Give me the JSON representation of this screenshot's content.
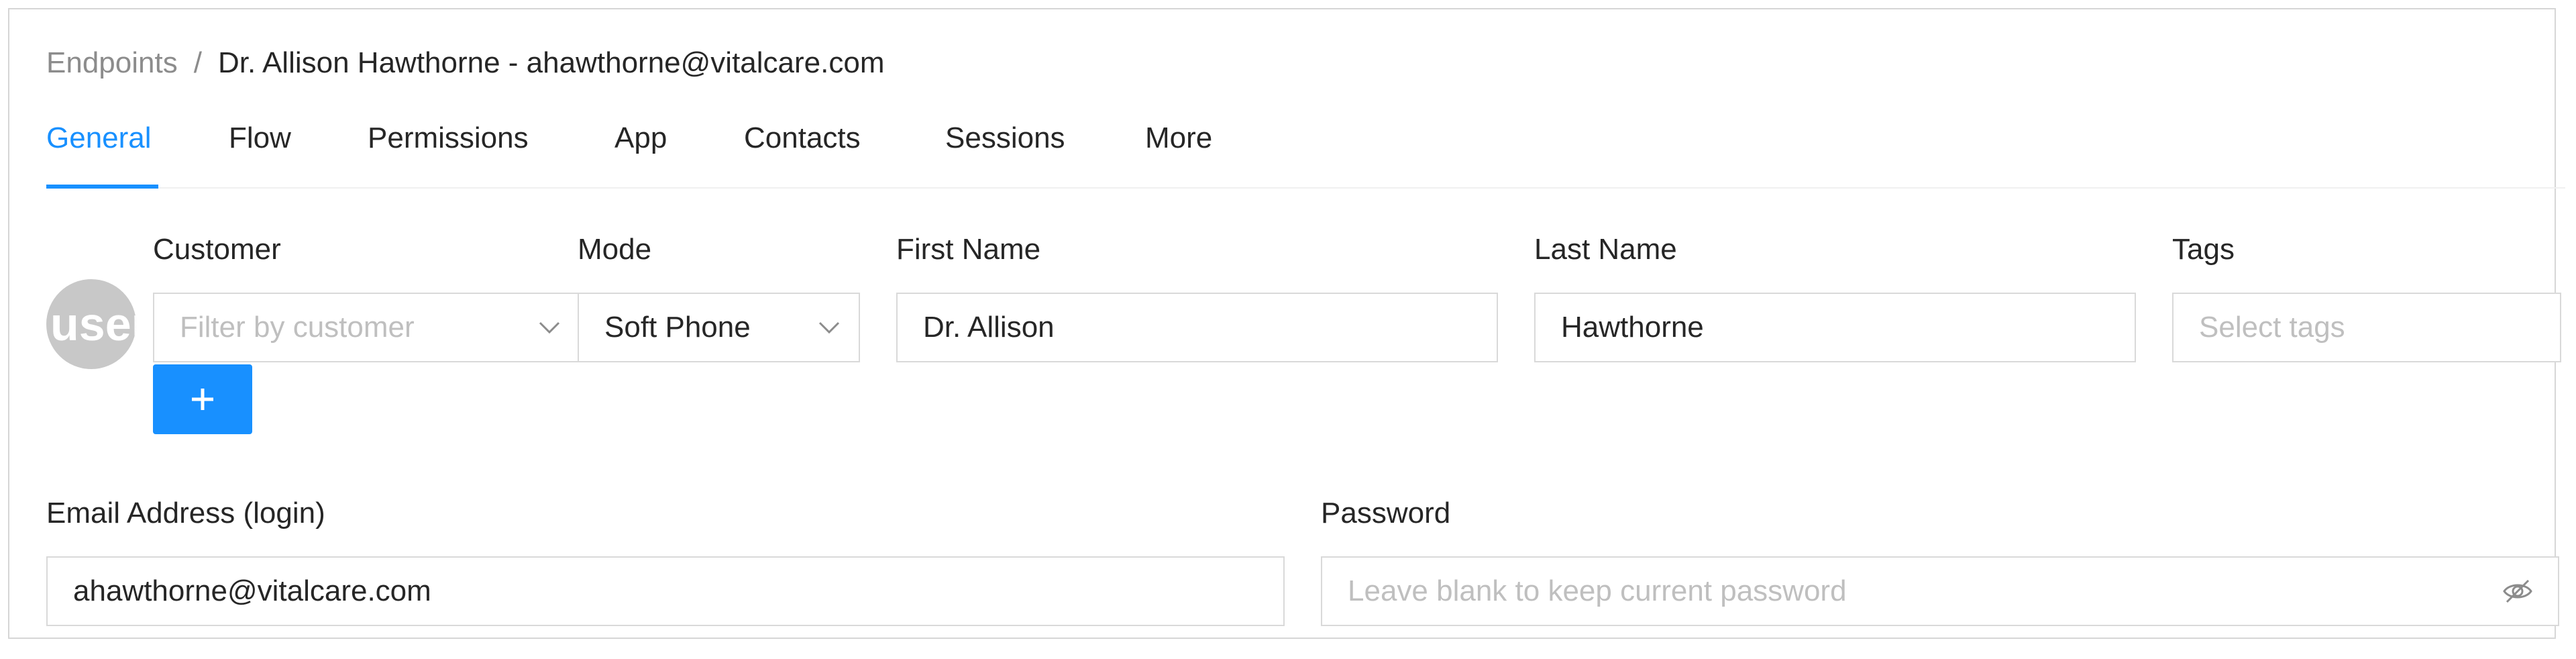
{
  "breadcrumb": {
    "root": "Endpoints",
    "separator": "/",
    "current": "Dr. Allison Hawthorne - ahawthorne@vitalcare.com"
  },
  "tabs": [
    {
      "label": "General",
      "active": true
    },
    {
      "label": "Flow",
      "active": false
    },
    {
      "label": "Permissions",
      "active": false
    },
    {
      "label": "App",
      "active": false
    },
    {
      "label": "Contacts",
      "active": false
    },
    {
      "label": "Sessions",
      "active": false
    },
    {
      "label": "More",
      "active": false
    }
  ],
  "avatar": {
    "text": "user"
  },
  "form": {
    "customer": {
      "label": "Customer",
      "placeholder": "Filter by customer",
      "value": ""
    },
    "mode": {
      "label": "Mode",
      "value": "Soft Phone"
    },
    "first_name": {
      "label": "First Name",
      "value": "Dr. Allison"
    },
    "last_name": {
      "label": "Last Name",
      "value": "Hawthorne"
    },
    "tags": {
      "label": "Tags",
      "placeholder": "Select tags"
    },
    "add_button": {
      "label": "+"
    },
    "email": {
      "label": "Email Address (login)",
      "value": "ahawthorne@vitalcare.com"
    },
    "password": {
      "label": "Password",
      "placeholder": "Leave blank to keep current password",
      "value": ""
    }
  },
  "colors": {
    "accent": "#1890ff",
    "border": "#d9d9d9",
    "placeholder": "#bfbfbf",
    "avatar_bg": "#c8c8c8"
  },
  "icons": {
    "select_arrow": "chevron-down-icon",
    "password_toggle": "eye-slash-icon",
    "add": "plus-icon"
  }
}
